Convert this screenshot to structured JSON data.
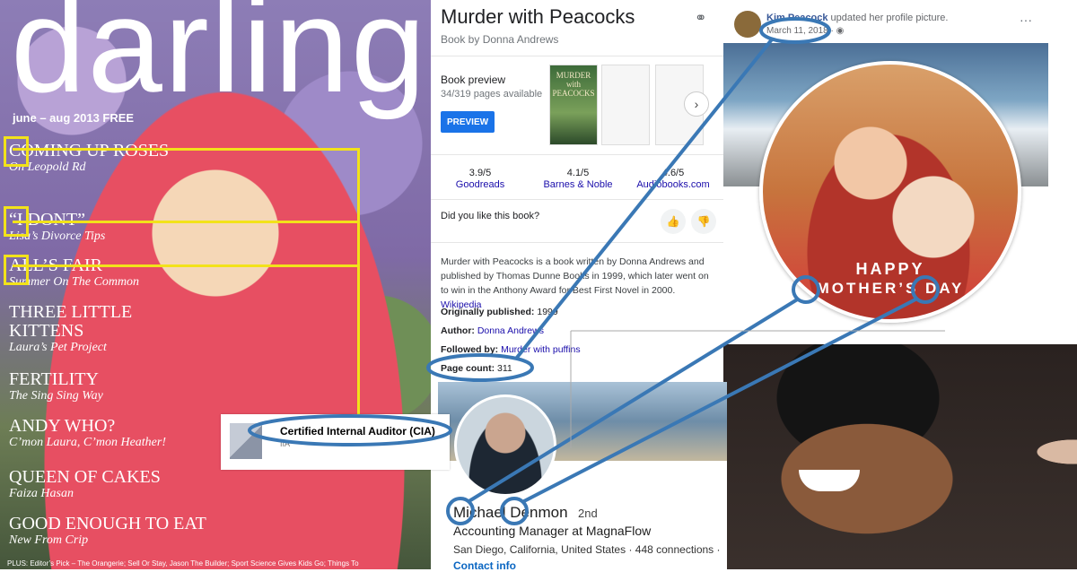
{
  "magazine": {
    "title": "darling",
    "issue": "june – aug 2013 FREE",
    "headlines": [
      {
        "title": "COMING UP ROSES",
        "sub": "On Leopold Rd"
      },
      {
        "title": "“I DONT”",
        "sub": "Lisa’s Divorce Tips"
      },
      {
        "title": "ALL’S FAIR",
        "sub": "Summer On The Common"
      },
      {
        "title": "THREE LITTLE KITTENS",
        "sub": "Laura’s Pet Project"
      },
      {
        "title": "FERTILITY",
        "sub": "The Sing Sing Way"
      },
      {
        "title": "ANDY WHO?",
        "sub": "C’mon Laura, C’mon Heather!"
      },
      {
        "title": "QUEEN OF CAKES",
        "sub": "Faiza Hasan"
      },
      {
        "title": "GOOD ENOUGH TO EAT",
        "sub": "New From Crip"
      }
    ],
    "plus_line": "PLUS: Editor’s Pick – The Orangerie; Sell Or Stay, Jason The Builder; Sport Science Gives Kids Go; Things To"
  },
  "google": {
    "title": "Murder with Peacocks",
    "subtitle": "Book by Donna Andrews",
    "preview_label": "Book preview",
    "pages_available": "34/319 pages available",
    "preview_button": "PREVIEW",
    "ratings": [
      {
        "value": "3.9/5",
        "source": "Goodreads"
      },
      {
        "value": "4.1/5",
        "source": "Barnes & Noble"
      },
      {
        "value": "4.6/5",
        "source": "Audiobooks.com"
      }
    ],
    "like_prompt": "Did you like this book?",
    "description": "Murder with Peacocks is a book written by Donna Andrews and published by Thomas Dunne Books in 1999, which later went on to win in the Anthony Award for Best First Novel in 2000.",
    "wikipedia": "Wikipedia",
    "originally_published_label": "Originally published:",
    "originally_published": "1999",
    "author_label": "Author:",
    "author": "Donna Andrews",
    "followed_by_label": "Followed by:",
    "followed_by": "Murder with puffins",
    "page_count_label": "Page count:",
    "page_count": "311",
    "cover_text": "MURDER with PEACOCKS"
  },
  "facebook": {
    "user": "Kim Peacock",
    "action": "updated her profile picture.",
    "date": "March 11, 2018 · ",
    "more": "···",
    "banner_line1": "HAPPY",
    "banner_line2": "MOTHER’S DAY"
  },
  "linkedin": {
    "name": "Michael Denmon",
    "degree": "2nd",
    "headline": "Accounting Manager at MagnaFlow",
    "location": "San Diego, California, United States · 448 connections ·",
    "contact": "Contact info"
  },
  "cert": {
    "name": "Certified Internal Auditor (CIA)",
    "org": "IIA"
  },
  "colors": {
    "annotation": "#3a78b5",
    "highlight": "#f2e21a",
    "link": "#1a0dab"
  }
}
